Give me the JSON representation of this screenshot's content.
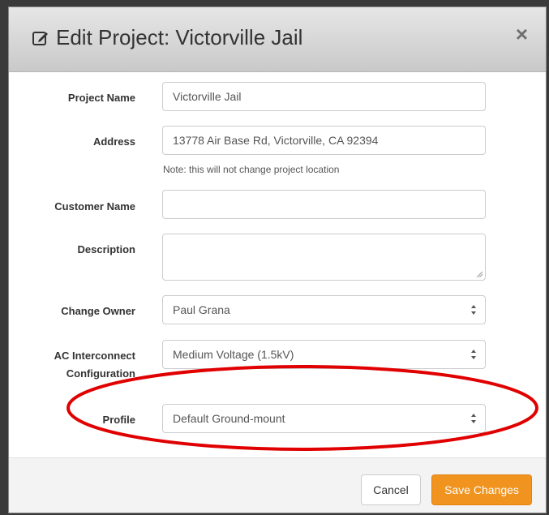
{
  "modal": {
    "title": "Edit Project: Victorville Jail",
    "close_label": "×"
  },
  "form": {
    "project_name": {
      "label": "Project Name",
      "value": "Victorville Jail"
    },
    "address": {
      "label": "Address",
      "value": "13778 Air Base Rd, Victorville, CA 92394",
      "help": "Note: this will not change project location"
    },
    "customer_name": {
      "label": "Customer Name",
      "value": ""
    },
    "description": {
      "label": "Description",
      "value": ""
    },
    "change_owner": {
      "label": "Change Owner",
      "selected": "Paul Grana"
    },
    "ac_interconnect": {
      "label_line1": "AC Interconnect",
      "label_line2": "Configuration",
      "selected": "Medium Voltage (1.5kV)"
    },
    "profile": {
      "label": "Profile",
      "selected": "Default Ground-mount"
    }
  },
  "footer": {
    "cancel_label": "Cancel",
    "save_label": "Save Changes"
  },
  "colors": {
    "save_button": "#f0931f",
    "highlight": "#e00000"
  },
  "icons": {
    "header": "edit-icon",
    "close": "close-icon",
    "select": "select-arrows-icon"
  }
}
